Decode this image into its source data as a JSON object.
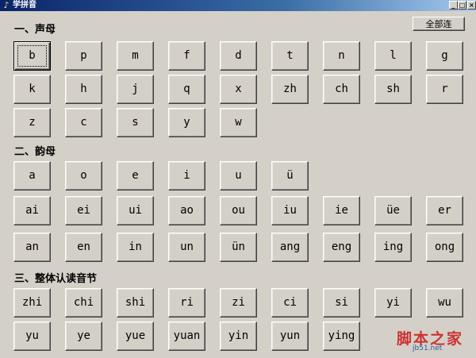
{
  "window": {
    "title": "学拼音",
    "minimize": "_",
    "maximize": "□",
    "close": "×"
  },
  "toolbar": {
    "all_label": "全部连"
  },
  "sections": {
    "initials": {
      "title": "一、声母",
      "items": [
        "b",
        "p",
        "m",
        "f",
        "d",
        "t",
        "n",
        "l",
        "g",
        "k",
        "h",
        "j",
        "q",
        "x",
        "zh",
        "ch",
        "sh",
        "r",
        "z",
        "c",
        "s",
        "y",
        "w"
      ]
    },
    "finals": {
      "title": "二、韵母",
      "items": [
        "a",
        "o",
        "e",
        "i",
        "u",
        "ü",
        "ai",
        "ei",
        "ui",
        "ao",
        "ou",
        "iu",
        "ie",
        "üe",
        "er",
        "an",
        "en",
        "in",
        "un",
        "ün",
        "ang",
        "eng",
        "ing",
        "ong"
      ]
    },
    "whole": {
      "title": "三、整体认读音节",
      "items": [
        "zhi",
        "chi",
        "shi",
        "ri",
        "zi",
        "ci",
        "si",
        "yi",
        "wu",
        "yu",
        "ye",
        "yue",
        "yuan",
        "yin",
        "yun",
        "ying"
      ]
    }
  },
  "watermark": {
    "text": "脚本之家",
    "sub": "jb51.net"
  }
}
